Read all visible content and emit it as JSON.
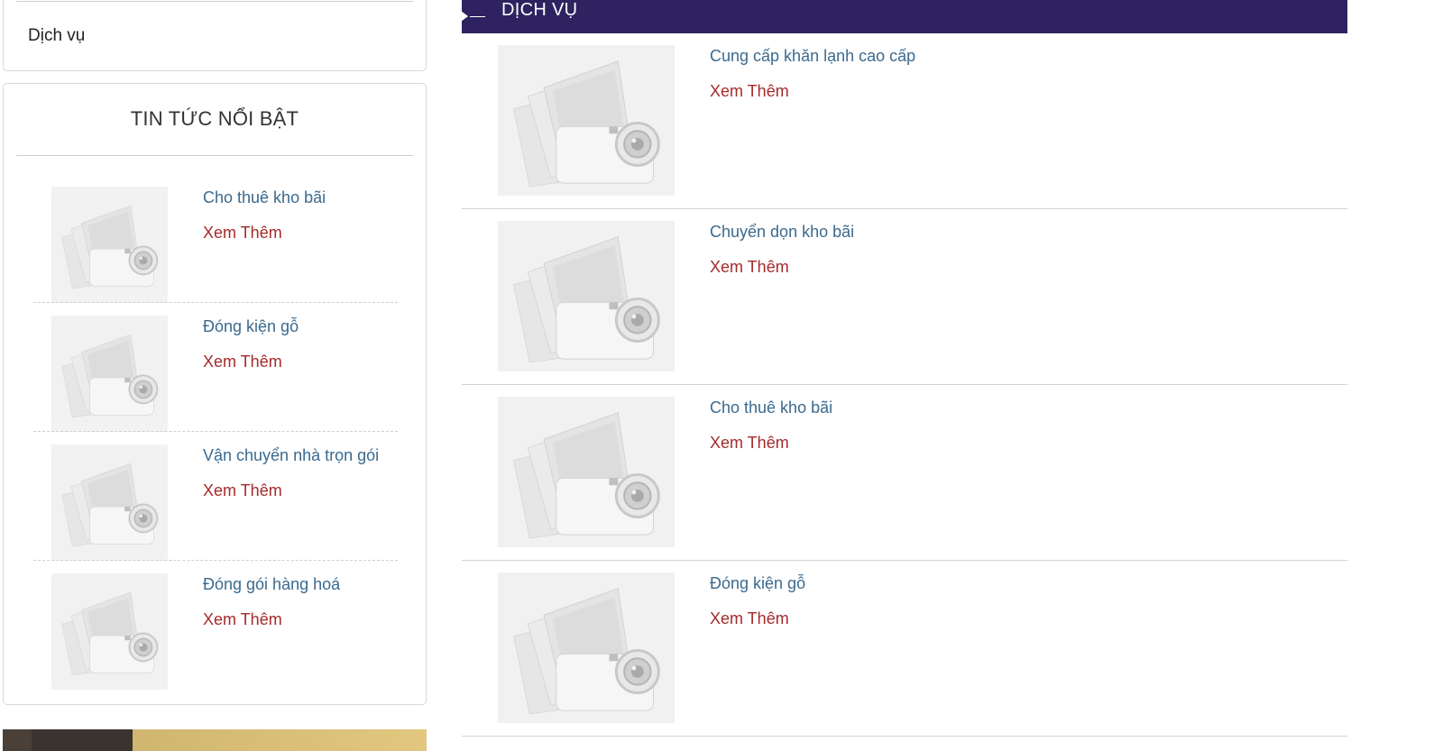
{
  "sidebar": {
    "menu_item": "Dịch vụ",
    "news_title": "TIN TỨC NỔI BẬT",
    "news": [
      {
        "title": "Cho thuê kho bãi",
        "more": "Xem Thêm"
      },
      {
        "title": "Đóng kiện gỗ",
        "more": "Xem Thêm"
      },
      {
        "title": "Vận chuyển nhà trọn gói",
        "more": "Xem Thêm"
      },
      {
        "title": "Đóng gói hàng hoá",
        "more": "Xem Thêm"
      }
    ]
  },
  "main": {
    "section_title": "DỊCH VỤ",
    "services": [
      {
        "title": "Cung cấp khăn lạnh cao cấp",
        "more": "Xem Thêm"
      },
      {
        "title": "Chuyển dọn kho bãi",
        "more": "Xem Thêm"
      },
      {
        "title": "Cho thuê kho bãi",
        "more": "Xem Thêm"
      },
      {
        "title": "Đóng kiện gỗ",
        "more": "Xem Thêm"
      }
    ]
  },
  "colors": {
    "header_bg": "#2e2360",
    "title_link": "#3b6a8e",
    "more_link": "#a52a2a"
  },
  "icons": {
    "thumbnail": "camera-placeholder-icon",
    "header_marker": "arrow-right-icon"
  }
}
